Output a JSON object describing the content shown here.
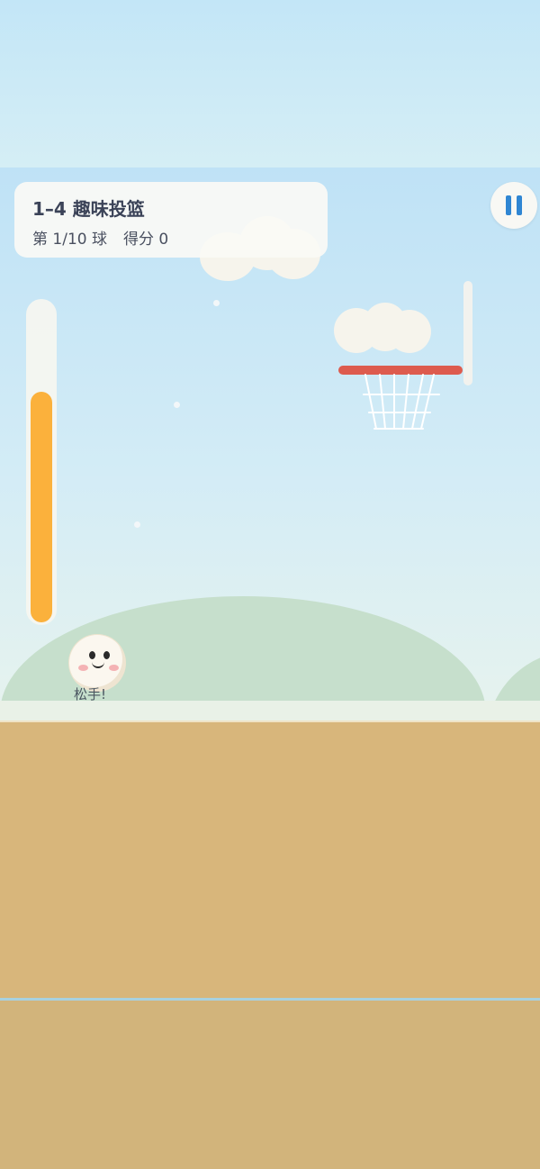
{
  "hud": {
    "level_title": "1–4 趣味投篮",
    "ball_counter": "第 1/10 球",
    "score_text": "得分 0"
  },
  "pause_button": {
    "icon": "pause-icon"
  },
  "power_meter": {
    "fill_fraction": 0.72,
    "color": "#fbb13c"
  },
  "ball": {
    "hint": "松手!"
  },
  "colors": {
    "sky_top": "#bfe2f6",
    "hill": "#c6dfcc",
    "court": "#d8b67b",
    "rim": "#dd5b4e",
    "pause_accent": "#2f86d3"
  }
}
